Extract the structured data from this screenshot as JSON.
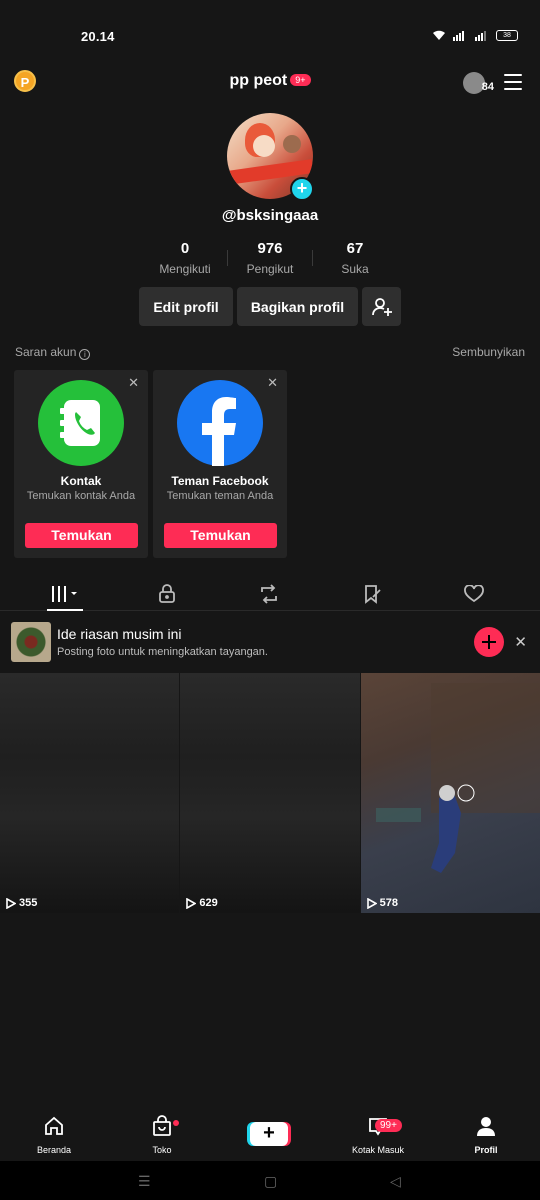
{
  "status": {
    "time": "20.14",
    "battery": "38"
  },
  "topbar": {
    "coin_label": "P",
    "title": "pp peot",
    "title_badge": "9+",
    "friend_count": "84"
  },
  "profile": {
    "username": "@bsksingaaa"
  },
  "stats": [
    {
      "value": "0",
      "label": "Mengikuti"
    },
    {
      "value": "976",
      "label": "Pengikut"
    },
    {
      "value": "67",
      "label": "Suka"
    }
  ],
  "actions": {
    "edit": "Edit profil",
    "share": "Bagikan profil"
  },
  "suggestions": {
    "title": "Saran akun",
    "hide": "Sembunyikan",
    "cards": [
      {
        "name": "Kontak",
        "sub": "Temukan kontak Anda",
        "button": "Temukan",
        "color": "#25c03a"
      },
      {
        "name": "Teman Facebook",
        "sub": "Temukan teman Anda",
        "button": "Temukan",
        "color": "#1877f2"
      }
    ]
  },
  "tabs": [
    "videos-grid-icon",
    "lock-icon",
    "repost-icon",
    "bookmark-icon",
    "heart-icon"
  ],
  "banner": {
    "title": "Ide riasan musim ini",
    "sub": "Posting foto untuk meningkatkan tayangan."
  },
  "videos": [
    {
      "views": "355"
    },
    {
      "views": "629"
    },
    {
      "views": "578"
    }
  ],
  "nav": {
    "home": "Beranda",
    "shop": "Toko",
    "inbox": "Kotak Masuk",
    "inbox_badge": "99+",
    "profile": "Profil"
  },
  "colors": {
    "accent": "#fe2c55",
    "cyan": "#20d5ec",
    "bg": "#161616"
  }
}
